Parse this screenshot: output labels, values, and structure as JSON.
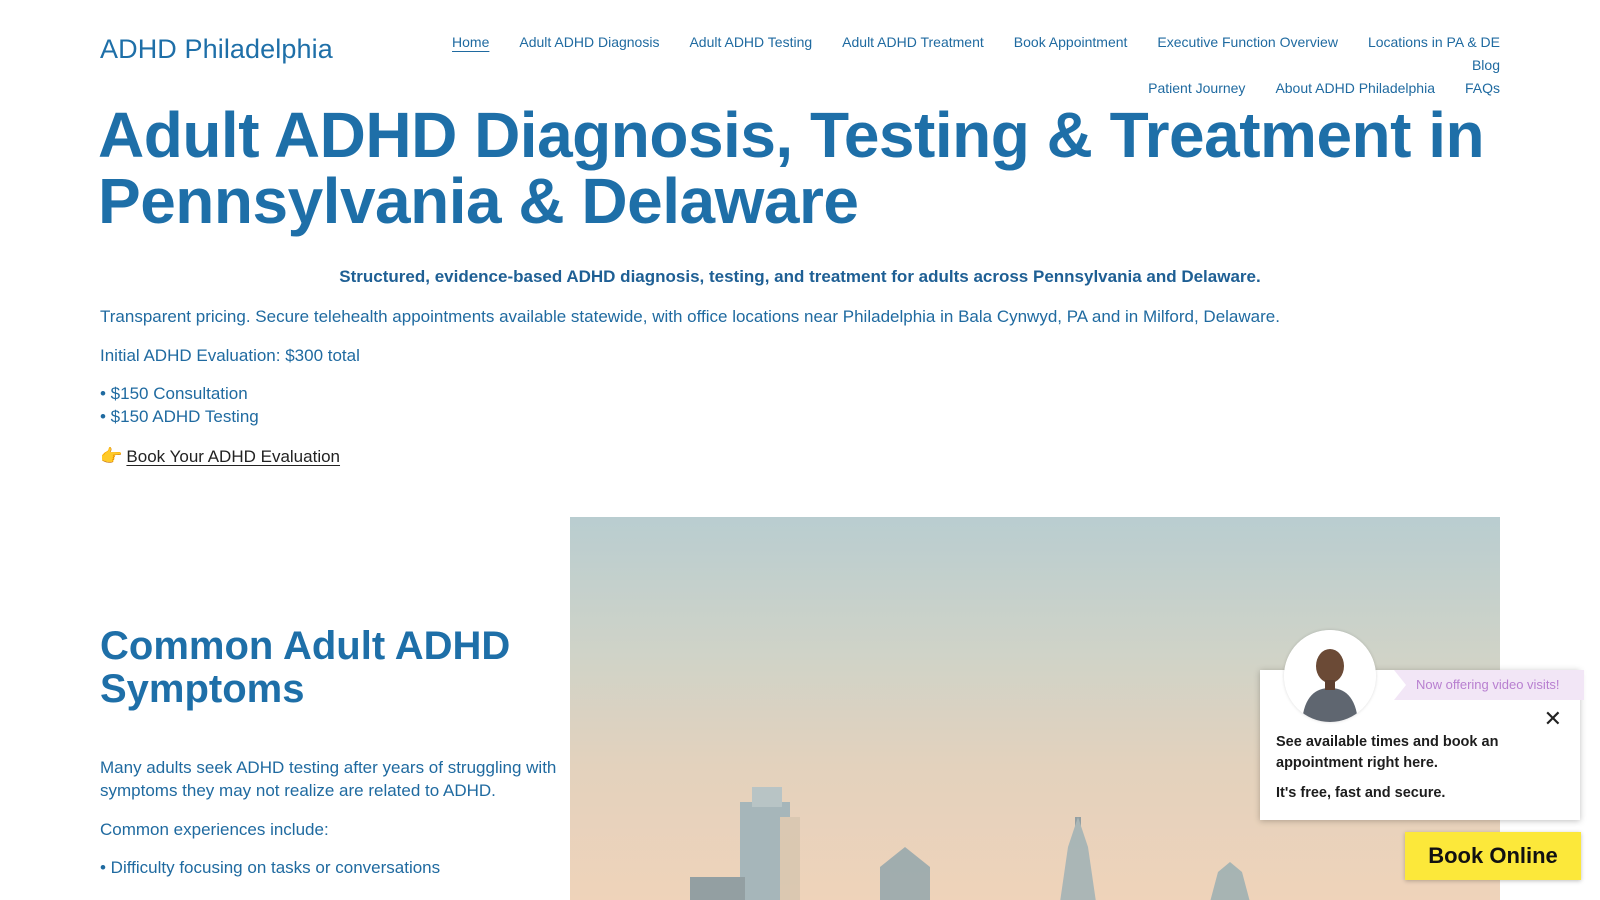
{
  "header": {
    "site_title": "ADHD Philadelphia",
    "nav": [
      {
        "label": "Home",
        "active": true
      },
      {
        "label": "Adult ADHD Diagnosis"
      },
      {
        "label": "Adult ADHD Testing"
      },
      {
        "label": "Adult ADHD Treatment"
      },
      {
        "label": "Book Appointment"
      },
      {
        "label": "Executive Function Overview"
      },
      {
        "label": "Locations in PA & DE"
      },
      {
        "label": "Blog"
      },
      {
        "label": "Patient Journey"
      },
      {
        "label": "About ADHD Philadelphia"
      },
      {
        "label": "FAQs"
      }
    ]
  },
  "hero": {
    "title": "Adult ADHD Diagnosis, Testing & Treatment in Pennsylvania & Delaware",
    "tagline": "Structured, evidence-based ADHD diagnosis, testing, and treatment for adults across Pennsylvania and Delaware.",
    "pricing_intro": "Transparent pricing. Secure telehealth appointments available statewide, with office locations near Philadelphia in Bala Cynwyd, PA and in Milford, Delaware.",
    "evaluation_total": "Initial ADHD Evaluation: $300 total",
    "price_items": [
      "• $150 Consultation",
      "• $150 ADHD Testing"
    ],
    "cta_icon": "👉",
    "cta_label": "Book Your ADHD Evaluation"
  },
  "symptoms": {
    "heading": "Common Adult ADHD Symptoms",
    "intro": "Many adults seek ADHD testing after years of struggling with symptoms they may not realize are related to ADHD.",
    "lead": "Common experiences include:",
    "items": [
      "• Difficulty focusing on tasks or conversations"
    ]
  },
  "widget": {
    "ribbon": "Now offering video visits!",
    "message": "See available times and book an appointment right here.",
    "sub": "It's free, fast and secure.",
    "close_icon": "close-icon",
    "book_button": "Book Online"
  },
  "colors": {
    "brand_blue": "#1e6fa8",
    "book_button_yellow": "#fce83a",
    "ribbon_purple": "#b87fd0"
  }
}
